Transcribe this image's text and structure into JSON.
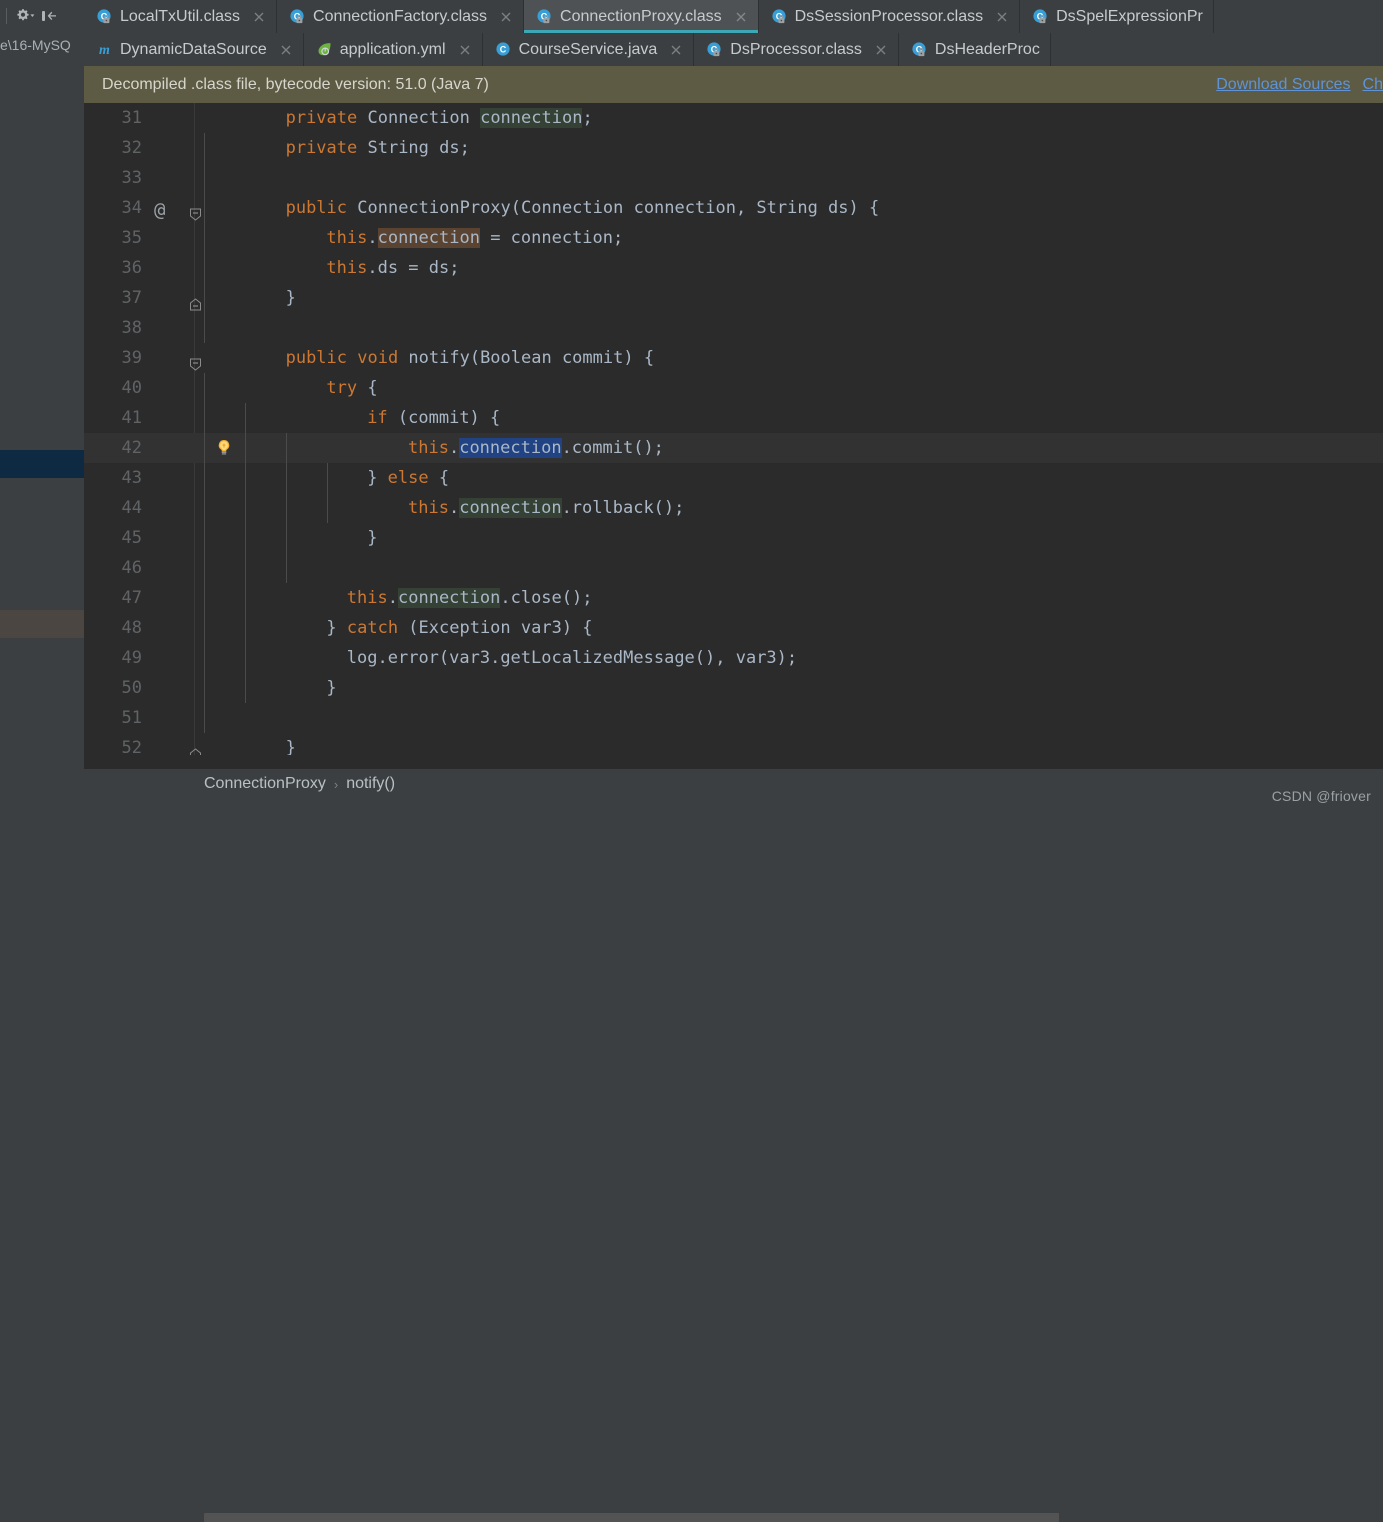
{
  "left_panel": {
    "path_fragment": "e\\16-MySQ",
    "toolbar": {
      "settings_icon": "gear-dropdown-icon",
      "collapse_icon": "collapse-panel-icon"
    }
  },
  "tab_rows": [
    {
      "tabs": [
        {
          "label": "LocalTxUtil.class",
          "icon": "java-class-locked-icon",
          "active": false,
          "closable": true
        },
        {
          "label": "ConnectionFactory.class",
          "icon": "java-class-locked-icon",
          "active": false,
          "closable": true
        },
        {
          "label": "ConnectionProxy.class",
          "icon": "java-class-locked-icon",
          "active": true,
          "closable": true
        },
        {
          "label": "DsSessionProcessor.class",
          "icon": "java-class-locked-icon",
          "active": false,
          "closable": true
        },
        {
          "label": "DsSpelExpressionPr",
          "icon": "java-class-locked-icon",
          "active": false,
          "closable": false
        }
      ]
    },
    {
      "tabs": [
        {
          "label": "DynamicDataSource",
          "icon": "mapper-m-icon",
          "active": false,
          "closable": true
        },
        {
          "label": "application.yml",
          "icon": "spring-leaf-icon",
          "active": false,
          "closable": true
        },
        {
          "label": "CourseService.java",
          "icon": "java-class-icon",
          "active": false,
          "closable": true
        },
        {
          "label": "DsProcessor.class",
          "icon": "java-class-locked-icon",
          "active": false,
          "closable": true
        },
        {
          "label": "DsHeaderProc",
          "icon": "java-class-locked-icon",
          "active": false,
          "closable": false
        }
      ]
    }
  ],
  "notification": {
    "message": "Decompiled .class file, bytecode version: 51.0 (Java 7)",
    "links": [
      "Download Sources",
      "Ch"
    ]
  },
  "editor": {
    "lines": [
      {
        "no": "31",
        "indent": 8,
        "segments": [
          {
            "t": "private ",
            "c": "kw"
          },
          {
            "t": "Connection ",
            "c": "txt"
          },
          {
            "t": "connection",
            "c": "hl-read"
          },
          {
            "t": ";",
            "c": "txt"
          }
        ]
      },
      {
        "no": "32",
        "indent": 8,
        "segments": [
          {
            "t": "private ",
            "c": "kw"
          },
          {
            "t": "String ds;",
            "c": "txt"
          }
        ]
      },
      {
        "no": "33",
        "indent": 0,
        "segments": []
      },
      {
        "no": "34",
        "indent": 8,
        "marker": "@",
        "fold": "open",
        "segments": [
          {
            "t": "public ",
            "c": "kw"
          },
          {
            "t": "ConnectionProxy(Connection connection, String ds) {",
            "c": "txt"
          }
        ]
      },
      {
        "no": "35",
        "indent": 12,
        "segments": [
          {
            "t": "this",
            "c": "kw"
          },
          {
            "t": ".",
            "c": "txt"
          },
          {
            "t": "connection",
            "c": "hl-write"
          },
          {
            "t": " = connection;",
            "c": "txt"
          }
        ]
      },
      {
        "no": "36",
        "indent": 12,
        "segments": [
          {
            "t": "this",
            "c": "kw"
          },
          {
            "t": ".ds = ds;",
            "c": "txt"
          }
        ]
      },
      {
        "no": "37",
        "indent": 8,
        "fold": "end",
        "segments": [
          {
            "t": "}",
            "c": "txt"
          }
        ]
      },
      {
        "no": "38",
        "indent": 0,
        "segments": []
      },
      {
        "no": "39",
        "indent": 8,
        "fold": "open",
        "segments": [
          {
            "t": "public void ",
            "c": "kw"
          },
          {
            "t": "notify(Boolean commit) {",
            "c": "txt"
          }
        ]
      },
      {
        "no": "40",
        "indent": 12,
        "segments": [
          {
            "t": "try",
            "c": "kw"
          },
          {
            "t": " {",
            "c": "txt"
          }
        ]
      },
      {
        "no": "41",
        "indent": 16,
        "segments": [
          {
            "t": "if",
            "c": "kw"
          },
          {
            "t": " (commit) {",
            "c": "txt"
          }
        ]
      },
      {
        "no": "42",
        "indent": 20,
        "caret": true,
        "marker": "lightbulb",
        "segments": [
          {
            "t": "this",
            "c": "kw"
          },
          {
            "t": ".",
            "c": "txt"
          },
          {
            "t": "connection",
            "c": "hl-sel"
          },
          {
            "t": ".commit();",
            "c": "txt"
          }
        ]
      },
      {
        "no": "43",
        "indent": 16,
        "segments": [
          {
            "t": "} ",
            "c": "txt"
          },
          {
            "t": "else",
            "c": "kw"
          },
          {
            "t": " {",
            "c": "txt"
          }
        ]
      },
      {
        "no": "44",
        "indent": 20,
        "segments": [
          {
            "t": "this",
            "c": "kw"
          },
          {
            "t": ".",
            "c": "txt"
          },
          {
            "t": "connection",
            "c": "hl-read"
          },
          {
            "t": ".rollback();",
            "c": "txt"
          }
        ]
      },
      {
        "no": "45",
        "indent": 16,
        "segments": [
          {
            "t": "}",
            "c": "txt"
          }
        ]
      },
      {
        "no": "46",
        "indent": 0,
        "segments": []
      },
      {
        "no": "47",
        "indent": 14,
        "segments": [
          {
            "t": "this",
            "c": "kw"
          },
          {
            "t": ".",
            "c": "txt"
          },
          {
            "t": "connection",
            "c": "hl-read"
          },
          {
            "t": ".close();",
            "c": "txt"
          }
        ]
      },
      {
        "no": "48",
        "indent": 12,
        "segments": [
          {
            "t": "} ",
            "c": "txt"
          },
          {
            "t": "catch",
            "c": "kw"
          },
          {
            "t": " (Exception var3) {",
            "c": "txt"
          }
        ]
      },
      {
        "no": "49",
        "indent": 14,
        "segments": [
          {
            "t": "log.error(var3.getLocalizedMessage(), var3);",
            "c": "txt"
          }
        ]
      },
      {
        "no": "50",
        "indent": 12,
        "segments": [
          {
            "t": "}",
            "c": "txt"
          }
        ]
      },
      {
        "no": "51",
        "indent": 0,
        "segments": []
      },
      {
        "no": "52",
        "indent": 8,
        "fold": "end",
        "segments": [
          {
            "t": "}",
            "c": "txt"
          }
        ]
      }
    ]
  },
  "breadcrumb": {
    "items": [
      "ConnectionProxy",
      "notify()"
    ],
    "separator": "›"
  },
  "watermark": "CSDN @friover",
  "colors": {
    "editor_bg": "#2b2b2b",
    "panel_bg": "#3c3f41",
    "accent_tab_underline": "#3ca7b5",
    "notification_bg": "#5d5b44",
    "link": "#5f93d6",
    "keyword": "#cc7832",
    "identifier": "#a9b7c6",
    "selection": "#214283",
    "read_usage": "#344134",
    "write_usage": "#5a4331"
  }
}
